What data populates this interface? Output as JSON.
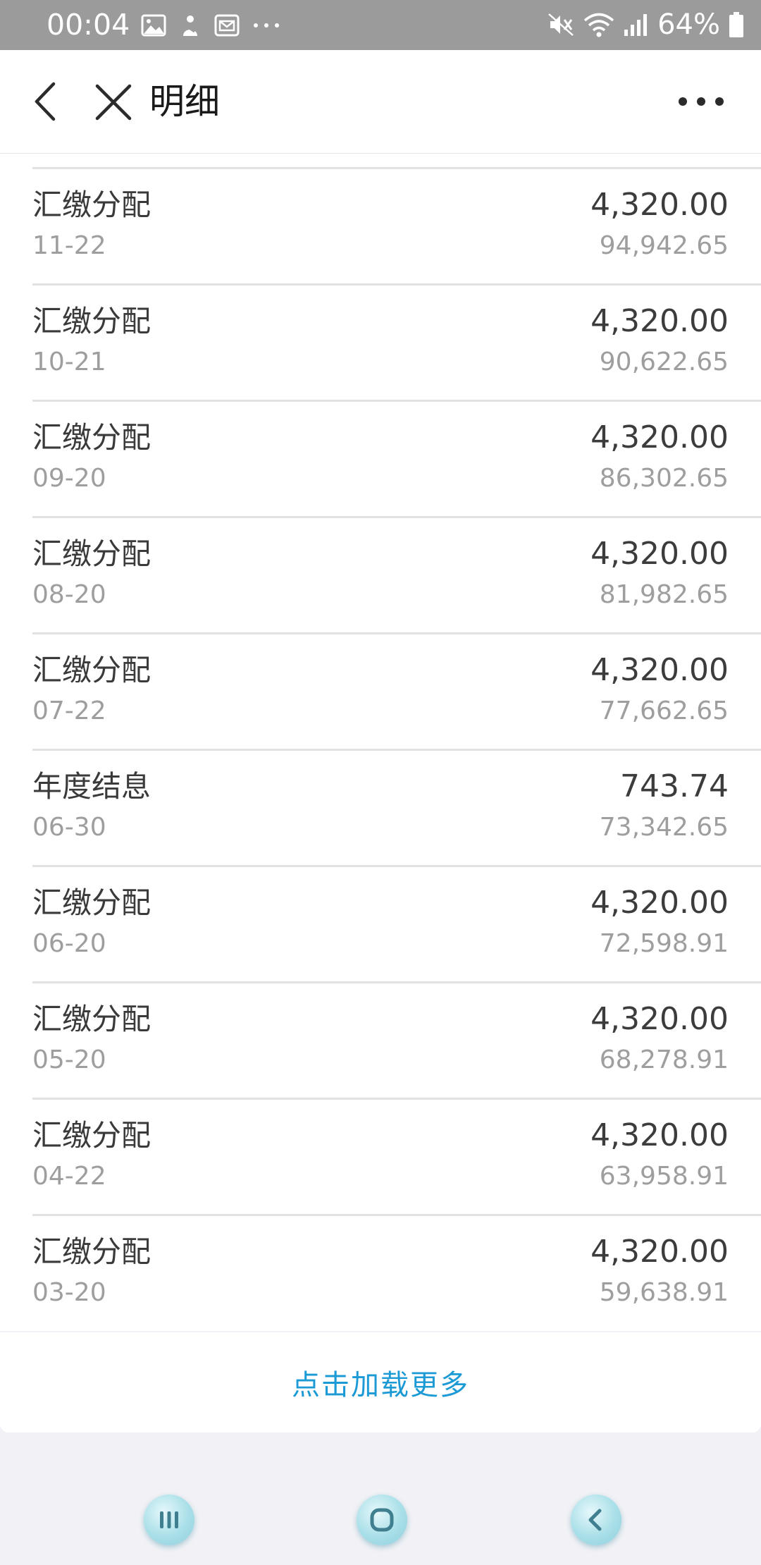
{
  "status_bar": {
    "time": "00:04",
    "battery_percent": "64%"
  },
  "header": {
    "title": "明细"
  },
  "transactions": [
    {
      "title": "汇缴分配",
      "date": "11-22",
      "amount": "4,320.00",
      "balance": "94,942.65"
    },
    {
      "title": "汇缴分配",
      "date": "10-21",
      "amount": "4,320.00",
      "balance": "90,622.65"
    },
    {
      "title": "汇缴分配",
      "date": "09-20",
      "amount": "4,320.00",
      "balance": "86,302.65"
    },
    {
      "title": "汇缴分配",
      "date": "08-20",
      "amount": "4,320.00",
      "balance": "81,982.65"
    },
    {
      "title": "汇缴分配",
      "date": "07-22",
      "amount": "4,320.00",
      "balance": "77,662.65"
    },
    {
      "title": "年度结息",
      "date": "06-30",
      "amount": "743.74",
      "balance": "73,342.65"
    },
    {
      "title": "汇缴分配",
      "date": "06-20",
      "amount": "4,320.00",
      "balance": "72,598.91"
    },
    {
      "title": "汇缴分配",
      "date": "05-20",
      "amount": "4,320.00",
      "balance": "68,278.91"
    },
    {
      "title": "汇缴分配",
      "date": "04-22",
      "amount": "4,320.00",
      "balance": "63,958.91"
    },
    {
      "title": "汇缴分配",
      "date": "03-20",
      "amount": "4,320.00",
      "balance": "59,638.91"
    }
  ],
  "load_more": {
    "label": "点击加载更多"
  },
  "colors": {
    "accent": "#1c9ad6",
    "status_bar": "#9b9b9b",
    "nav_button": "#a9dfe8"
  },
  "icons": {
    "status_left": [
      "image-icon",
      "app-notification-icon",
      "mail-icon",
      "more-notifications-icon"
    ],
    "status_right": [
      "mute-icon",
      "wifi-icon",
      "signal-icon",
      "battery-icon"
    ],
    "system_nav": [
      "recent-apps-icon",
      "home-icon",
      "back-icon"
    ]
  }
}
